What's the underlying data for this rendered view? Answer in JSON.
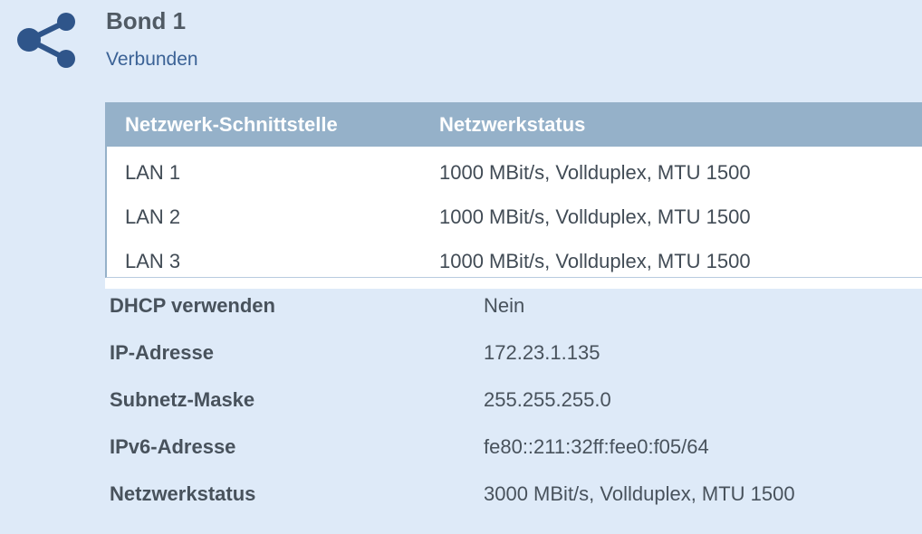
{
  "bond": {
    "title": "Bond 1",
    "status": "Verbunden",
    "icon": "share-icon"
  },
  "interfaces": {
    "headers": [
      "Netzwerk-Schnittstelle",
      "Netzwerkstatus"
    ],
    "rows": [
      [
        "LAN 1",
        "1000 MBit/s, Vollduplex, MTU 1500"
      ],
      [
        "LAN 2",
        "1000 MBit/s, Vollduplex, MTU 1500"
      ],
      [
        "LAN 3",
        "1000 MBit/s, Vollduplex, MTU 1500"
      ]
    ]
  },
  "details": [
    {
      "label": "DHCP verwenden",
      "value": "Nein"
    },
    {
      "label": "IP-Adresse",
      "value": "172.23.1.135"
    },
    {
      "label": "Subnetz-Maske",
      "value": "255.255.255.0"
    },
    {
      "label": "IPv6-Adresse",
      "value": "fe80::211:32ff:fee0:f05/64"
    },
    {
      "label": "Netzwerkstatus",
      "value": "3000 MBit/s, Vollduplex, MTU 1500"
    }
  ],
  "colors": {
    "background": "#deeaf8",
    "table_header": "#95b1c9",
    "status_link": "#3b6296",
    "icon": "#2f558a"
  }
}
